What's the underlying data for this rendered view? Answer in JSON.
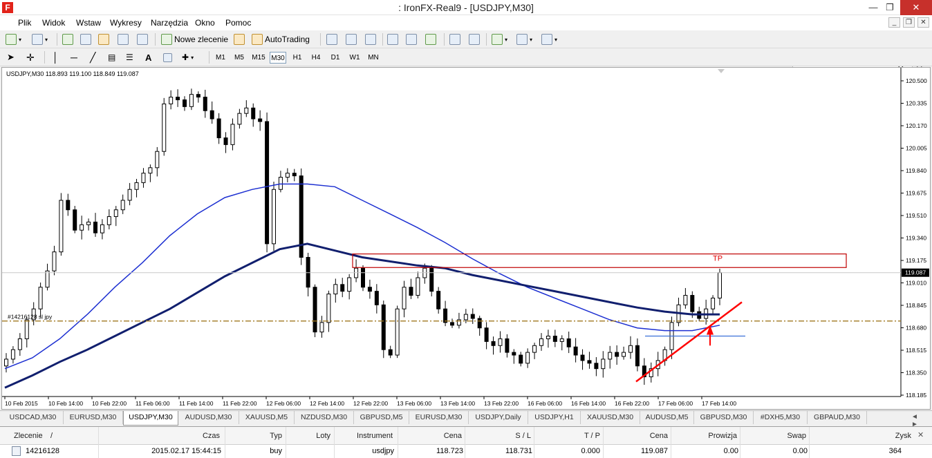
{
  "window": {
    "title": ": IronFX-Real9 - [USDJPY,M30]",
    "minimize": "—",
    "restore": "❐",
    "close": "✕"
  },
  "menu": [
    "Plik",
    "Widok",
    "Wstaw",
    "Wykresy",
    "Narzędzia",
    "Okno",
    "Pomoc"
  ],
  "mdi": {
    "minimize": "_",
    "restore": "❐",
    "close": "✕"
  },
  "toolbar": {
    "new_order": "Nowe zlecenie",
    "autotrading": "AutoTrading"
  },
  "timeframes": [
    "M1",
    "M5",
    "M15",
    "M30",
    "H1",
    "H4",
    "D1",
    "W1",
    "MN"
  ],
  "active_timeframe": "M30",
  "chart_header": "USDJPY,M30  118.893 119.100 118.849 119.087",
  "colors": {
    "candles": "#000000",
    "ma_fast": "#1c2fd1",
    "ma_slow": "#111f6e",
    "trend": "#ff0000",
    "tp_box": "#c00000",
    "order_line": "#a07820",
    "level": "#3a6fd8"
  },
  "chart_data": {
    "type": "line",
    "symbol": "USDJPY",
    "timeframe": "M30",
    "ohlc_header": {
      "open": 118.893,
      "high": 119.1,
      "low": 118.849,
      "close": 119.087
    },
    "last_price": "119.087",
    "y_ticks": [
      "120.500",
      "120.335",
      "120.170",
      "120.005",
      "119.840",
      "119.675",
      "119.510",
      "119.340",
      "119.175",
      "119.010",
      "118.845",
      "118.680",
      "118.515",
      "118.350",
      "118.185"
    ],
    "x_ticks": [
      "10 Feb 2015",
      "10 Feb 14:00",
      "10 Feb 22:00",
      "11 Feb 06:00",
      "11 Feb 14:00",
      "11 Feb 22:00",
      "12 Feb 06:00",
      "12 Feb 14:00",
      "12 Feb 22:00",
      "13 Feb 06:00",
      "13 Feb 14:00",
      "13 Feb 22:00",
      "16 Feb 06:00",
      "16 Feb 14:00",
      "16 Feb 22:00",
      "17 Feb 06:00",
      "17 Feb 14:00"
    ],
    "price_close": [
      118.45,
      118.52,
      118.6,
      118.74,
      118.82,
      118.98,
      119.1,
      119.24,
      119.62,
      119.55,
      119.4,
      119.44,
      119.46,
      119.38,
      119.44,
      119.5,
      119.55,
      119.62,
      119.7,
      119.75,
      119.82,
      119.86,
      119.98,
      120.33,
      120.38,
      120.36,
      120.31,
      120.4,
      120.38,
      120.28,
      120.22,
      120.08,
      120.03,
      120.18,
      120.26,
      120.3,
      120.22,
      120.2,
      119.3,
      119.7,
      119.79,
      119.82,
      119.8,
      119.2,
      118.98,
      118.65,
      118.72,
      118.93,
      119,
      118.95,
      119.05,
      119.12,
      118.98,
      118.95,
      118.85,
      118.52,
      118.48,
      118.82,
      118.98,
      118.92,
      119.05,
      119.12,
      118.95,
      118.82,
      118.72,
      118.7,
      118.74,
      118.78,
      118.75,
      118.68,
      118.58,
      118.55,
      118.6,
      118.5,
      118.48,
      118.42,
      118.5,
      118.55,
      118.6,
      118.62,
      118.58,
      118.6,
      118.54,
      118.48,
      118.44,
      118.42,
      118.38,
      118.45,
      118.5,
      118.47,
      118.5,
      118.55,
      118.4,
      118.32,
      118.38,
      118.44,
      118.52,
      118.72,
      118.85,
      118.92,
      118.8,
      118.75,
      118.82,
      118.9,
      119.087
    ],
    "ma_fast": [
      118.38,
      118.46,
      118.6,
      118.78,
      118.98,
      119.16,
      119.36,
      119.52,
      119.64,
      119.7,
      119.74,
      119.74,
      119.72,
      119.62,
      119.52,
      119.42,
      119.31,
      119.19,
      119.08,
      118.98,
      118.9,
      118.82,
      118.74,
      118.68,
      118.66,
      118.66,
      118.7
    ],
    "ma_slow": [
      118.24,
      118.33,
      118.43,
      118.52,
      118.62,
      118.72,
      118.82,
      118.94,
      119.06,
      119.16,
      119.26,
      119.3,
      119.25,
      119.2,
      119.17,
      119.14,
      119.12,
      119.07,
      119.03,
      118.99,
      118.95,
      118.91,
      118.87,
      118.83,
      118.8,
      118.78,
      118.78
    ],
    "tp_zone": [
      119.125,
      119.225
    ],
    "order_line": {
      "label": "#14216128 sl jpy",
      "price": 118.731
    },
    "tp_label": "TP",
    "support_level": 118.62,
    "trendline": [
      [
        4,
        118.24
      ],
      [
        1070,
        118.87
      ]
    ]
  },
  "tabs": [
    "USDCAD,M30",
    "EURUSD,M30",
    "USDJPY,M30",
    "AUDUSD,M30",
    "XAUUSD,M5",
    "NZDUSD,M30",
    "GBPUSD,M5",
    "EURUSD,M30",
    "USDJPY,Daily",
    "USDJPY,H1",
    "XAUUSD,M30",
    "AUDUSD,M5",
    "GBPUSD,M30",
    "#DXH5,M30",
    "GBPAUD,M30"
  ],
  "active_tab": 2,
  "tab_arrows": "◄ ►",
  "terminal": {
    "headers": {
      "order": "Zlecenie",
      "sort": "/",
      "time": "Czas",
      "type": "Typ",
      "lots": "Loty",
      "instrument": "Instrument",
      "price": "Cena",
      "sl": "S / L",
      "tp": "T / P",
      "current": "Cena",
      "commission": "Prowizja",
      "swap": "Swap",
      "profit": "Zysk"
    },
    "row": {
      "order": "14216128",
      "time": "2015.02.17 15:44:15",
      "type": "buy",
      "lots": "",
      "instrument": "usdjpy",
      "price": "118.723",
      "sl": "118.731",
      "tp": "0.000",
      "current": "119.087",
      "commission": "0.00",
      "swap": "0.00",
      "profit": "364"
    },
    "close": "✕"
  }
}
